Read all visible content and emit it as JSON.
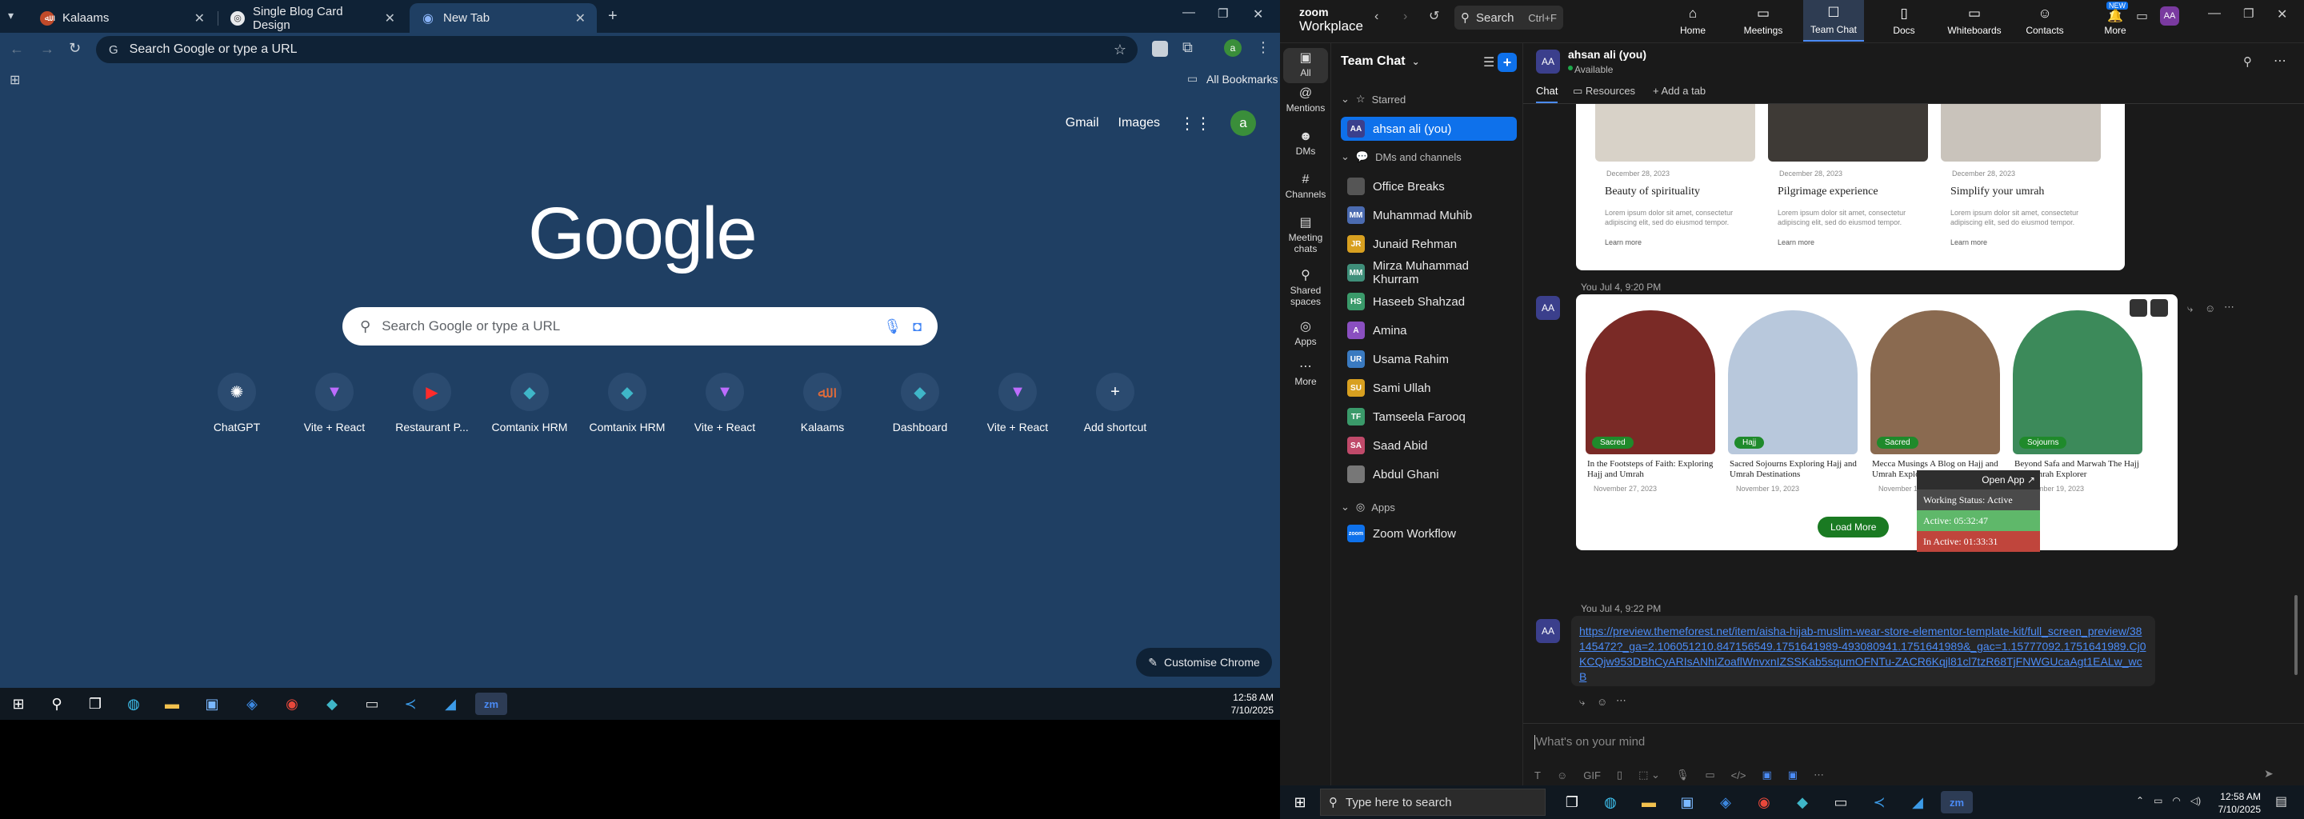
{
  "chrome": {
    "tabs": [
      {
        "title": "Kalaams",
        "favicon_color": "#c04a2a"
      },
      {
        "title": "Single Blog Card Design",
        "favicon_color": "#e8eaed"
      },
      {
        "title": "New Tab",
        "favicon_color": "#8ab4f8"
      }
    ],
    "omnibox_text": "Search Google or type a URL",
    "all_bookmarks": "All Bookmarks",
    "gmail": "Gmail",
    "images": "Images",
    "profile_initial": "a",
    "logo": "Google",
    "search_placeholder": "Search Google or type a URL",
    "shortcuts": [
      {
        "label": "ChatGPT",
        "icon": "chatgpt-icon",
        "glyph": "✺",
        "color": "#ffffff"
      },
      {
        "label": "Vite + React",
        "icon": "vite-icon",
        "glyph": "▼",
        "color": "#bd6cff"
      },
      {
        "label": "Restaurant P...",
        "icon": "youtube-icon",
        "glyph": "▶",
        "color": "#ff2b2b"
      },
      {
        "label": "Comtanix HRM",
        "icon": "hrm-icon",
        "glyph": "◆",
        "color": "#3fb6c8"
      },
      {
        "label": "Comtanix HRM",
        "icon": "hrm-icon",
        "glyph": "◆",
        "color": "#3fb6c8"
      },
      {
        "label": "Vite + React",
        "icon": "vite-icon",
        "glyph": "▼",
        "color": "#bd6cff"
      },
      {
        "label": "Kalaams",
        "icon": "kalaams-icon",
        "glyph": "ﷲ",
        "color": "#e06b3a"
      },
      {
        "label": "Dashboard",
        "icon": "dashboard-icon",
        "glyph": "◆",
        "color": "#3fb6c8"
      },
      {
        "label": "Vite + React",
        "icon": "vite-icon",
        "glyph": "▼",
        "color": "#bd6cff"
      },
      {
        "label": "Add shortcut",
        "icon": "plus-icon",
        "glyph": "+",
        "color": "#ffffff"
      }
    ],
    "customise": "Customise Chrome"
  },
  "taskbar_left": {
    "time": "12:58 AM",
    "date": "7/10/2025"
  },
  "zoom": {
    "logo_top": "zoom",
    "logo_bottom": "Workplace",
    "search": "Search",
    "search_shortcut": "Ctrl+F",
    "nav": [
      {
        "label": "Home",
        "icon": "home-icon",
        "glyph": "⌂"
      },
      {
        "label": "Meetings",
        "icon": "meetings-icon",
        "glyph": "▭"
      },
      {
        "label": "Team Chat",
        "icon": "chat-icon",
        "glyph": "☐"
      },
      {
        "label": "Docs",
        "icon": "docs-icon",
        "glyph": "▯"
      },
      {
        "label": "Whiteboards",
        "icon": "whiteboard-icon",
        "glyph": "▭"
      },
      {
        "label": "Contacts",
        "icon": "contacts-icon",
        "glyph": "☺"
      },
      {
        "label": "More",
        "icon": "more-icon",
        "glyph": "⋯"
      }
    ],
    "new_badge": "NEW",
    "user_initials": "AA",
    "rail": [
      {
        "label": "All",
        "icon": "all-icon",
        "glyph": "▣"
      },
      {
        "label": "Mentions",
        "icon": "mentions-icon",
        "glyph": "@"
      },
      {
        "label": "DMs",
        "icon": "dms-icon",
        "glyph": "☻"
      },
      {
        "label": "Channels",
        "icon": "channels-icon",
        "glyph": "#"
      },
      {
        "label": "Meeting chats",
        "icon": "meeting-chats-icon",
        "glyph": "▤"
      },
      {
        "label": "Shared spaces",
        "icon": "shared-spaces-icon",
        "glyph": "⚲"
      },
      {
        "label": "Apps",
        "icon": "apps-icon",
        "glyph": "◎"
      },
      {
        "label": "More",
        "icon": "more-icon",
        "glyph": "⋯"
      }
    ],
    "sidebar": {
      "title": "Team Chat",
      "starred": "Starred",
      "starred_item": {
        "name": "ahsan ali (you)",
        "initials": "AA"
      },
      "dms_section": "DMs and channels",
      "dms": [
        {
          "name": "Office Breaks",
          "initials": "",
          "color": "#555555"
        },
        {
          "name": "Muhammad Muhib",
          "initials": "MM",
          "color": "#4b6bb0"
        },
        {
          "name": "Junaid Rehman",
          "initials": "JR",
          "color": "#d8a020"
        },
        {
          "name": "Mirza Muhammad Khurram",
          "initials": "MM",
          "color": "#3f8f7a"
        },
        {
          "name": "Haseeb Shahzad",
          "initials": "HS",
          "color": "#3a9a6a"
        },
        {
          "name": "Amina",
          "initials": "A",
          "color": "#8a4fc0"
        },
        {
          "name": "Usama Rahim",
          "initials": "UR",
          "color": "#3a7ac0"
        },
        {
          "name": "Sami Ullah",
          "initials": "SU",
          "color": "#d8a020"
        },
        {
          "name": "Tamseela Farooq",
          "initials": "TF",
          "color": "#3a9a6a"
        },
        {
          "name": "Saad Abid",
          "initials": "SA",
          "color": "#c04a6a"
        },
        {
          "name": "Abdul Ghani",
          "initials": "",
          "color": "#777777"
        }
      ],
      "apps_section": "Apps",
      "apps": [
        {
          "name": "Zoom Workflow",
          "initials": "zoom",
          "color": "#0e71eb"
        }
      ]
    },
    "chat": {
      "name": "ahsan ali (you)",
      "status": "Available",
      "tabs": [
        "Chat",
        "Resources",
        "Add a tab"
      ],
      "top_card": {
        "blogs": [
          {
            "date": "December 28, 2023",
            "title": "Beauty of spirituality",
            "text": "Lorem ipsum dolor sit amet, consectetur adipiscing elit, sed do eiusmod tempor.",
            "more": "Learn more"
          },
          {
            "date": "December 28, 2023",
            "title": "Pilgrimage experience",
            "text": "Lorem ipsum dolor sit amet, consectetur adipiscing elit, sed do eiusmod tempor.",
            "more": "Learn more"
          },
          {
            "date": "December 28, 2023",
            "title": "Simplify your umrah",
            "text": "Lorem ipsum dolor sit amet, consectetur adipiscing elit, sed do eiusmod tempor.",
            "more": "Learn more"
          }
        ]
      },
      "msg2_meta": "You Jul 4, 9:20 PM",
      "card2": {
        "items": [
          {
            "tag": "Sacred",
            "title": "In the Footsteps of Faith: Exploring Hajj and Umrah",
            "date": "November 27, 2023"
          },
          {
            "tag": "Hajj",
            "title": "Sacred Sojourns Exploring Hajj and Umrah Destinations",
            "date": "November 19, 2023"
          },
          {
            "tag": "Sacred",
            "title": "Mecca Musings A Blog on Hajj and Umrah Exploration",
            "date": "November 19, 2023"
          },
          {
            "tag": "Sojourns",
            "title": "Beyond Safa and Marwah The Hajj and Umrah Explorer",
            "date": "November 19, 2023"
          }
        ],
        "load_more": "Load More"
      },
      "msg3_meta": "You Jul 4, 9:22 PM",
      "link": "https://preview.themeforest.net/item/aisha-hijab-muslim-wear-store-elementor-template-kit/full_screen_preview/38145472?_ga=2.106051210.847156549.1751641989-493080941.1751641989&_gac=1.15777092.1751641989.Cj0KCQjw953DBhCyARIsANhIZoaflWnvxnIZSSKab5squmOFNTu-ZACR6Kqjl81cl7tzR68TjFNWGUcaAgt1EALw_wcB",
      "composer_placeholder": "What's on your mind"
    },
    "widget": {
      "open_app": "Open App",
      "status": "Working Status: Active",
      "active": "Active: 05:32:47",
      "inactive": "In Active: 01:33:31"
    }
  },
  "taskbar_right": {
    "search": "Type here to search",
    "time": "12:58 AM",
    "date": "7/10/2025"
  }
}
